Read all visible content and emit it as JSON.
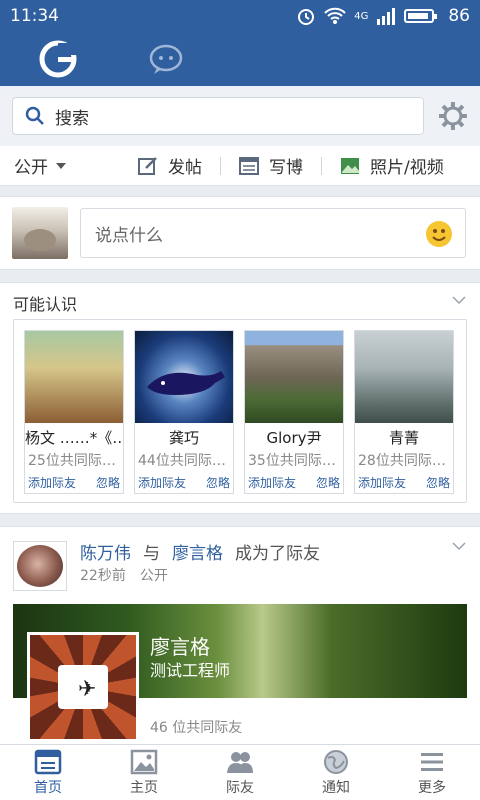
{
  "status_bar": {
    "time": "11:34",
    "network": "4G",
    "battery": "86"
  },
  "search": {
    "placeholder": "搜索"
  },
  "actions": {
    "visibility": "公开",
    "post": "发帖",
    "blog": "写博",
    "photo_video": "照片/视频"
  },
  "composer": {
    "placeholder": "说点什么"
  },
  "pymk": {
    "title": "可能认识",
    "add_label": "添加际友",
    "ignore_label": "忽略",
    "cards": [
      {
        "name": "杨文 ……*《…",
        "mutual": "25位共同际…"
      },
      {
        "name": "龚巧",
        "mutual": "44位共同际…"
      },
      {
        "name": "Glory尹",
        "mutual": "35位共同际…"
      },
      {
        "name": "青菁",
        "mutual": "28位共同际…"
      }
    ]
  },
  "feed": {
    "actor": "陈万伟",
    "connector": "与",
    "target": "廖言格",
    "action": "成为了际友",
    "time": "22秒前",
    "privacy": "公开",
    "profile": {
      "name": "廖言格",
      "title": "测试工程师",
      "mutual": "46 位共同际友"
    }
  },
  "nav": [
    {
      "label": "首页",
      "icon": "feed-icon",
      "active": true
    },
    {
      "label": "主页",
      "icon": "image-icon",
      "active": false
    },
    {
      "label": "际友",
      "icon": "people-icon",
      "active": false
    },
    {
      "label": "通知",
      "icon": "globe-icon",
      "active": false
    },
    {
      "label": "更多",
      "icon": "menu-icon",
      "active": false
    }
  ],
  "colors": {
    "brand": "#2f5f9f",
    "link": "#2f5f9f"
  }
}
